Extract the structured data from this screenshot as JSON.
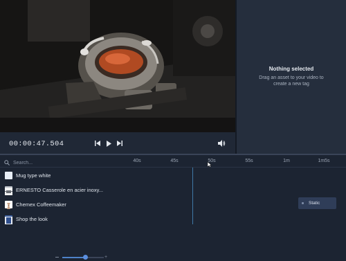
{
  "player": {
    "timecode": "00:00:47.504",
    "controls": [
      "skip-back",
      "play",
      "skip-forward",
      "volume"
    ]
  },
  "side_panel": {
    "title": "Nothing selected",
    "subtitle": "Drag an asset to your video to create a new tag"
  },
  "timeline": {
    "search_placeholder": "Search...",
    "ruler": [
      "40s",
      "45s",
      "50s",
      "55s",
      "1m",
      "1m5s"
    ],
    "tracks": [
      {
        "label": "Mug type white",
        "thumb_color": "#e8eef6"
      },
      {
        "label": "ERNESTO Casserole en acier inoxy...",
        "thumb_color": "#b9bec6"
      },
      {
        "label": "Chemex Coffeemaker",
        "thumb_color": "#ffffff"
      },
      {
        "label": "Shop the look",
        "thumb_color": "#3d5f9e"
      }
    ],
    "clip_label": "Static",
    "zoom_level": 0.55
  },
  "colors": {
    "accent": "#4e82c9",
    "playhead": "#3f7aa8",
    "panel_bg": "#252e3d",
    "timeline_bg": "#1c2432"
  }
}
